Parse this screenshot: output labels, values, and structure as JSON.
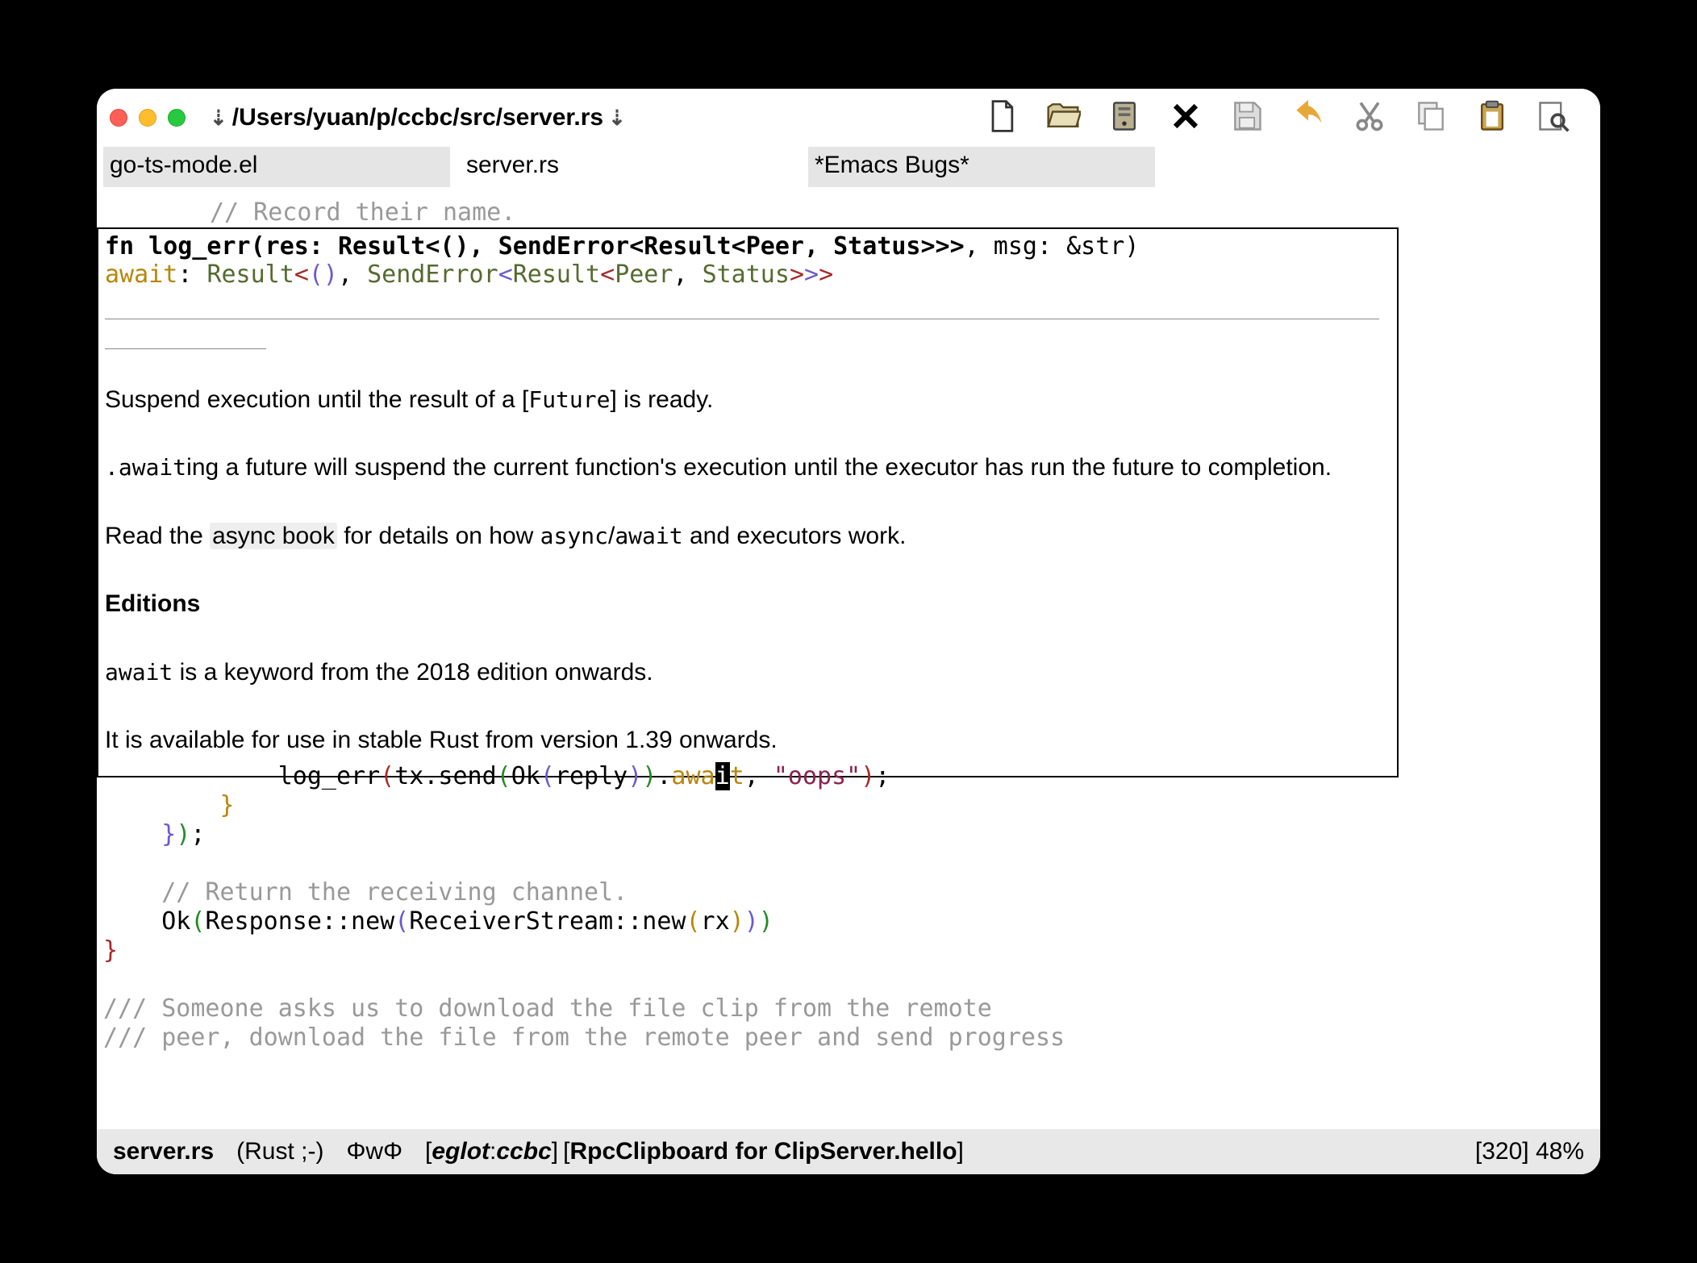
{
  "window": {
    "path": "/Users/yuan/p/ccbc/src/server.rs"
  },
  "tabs": [
    {
      "label": "go-ts-mode.el",
      "active": false
    },
    {
      "label": "server.rs",
      "active": true
    },
    {
      "label": "*Emacs Bugs*",
      "active": false
    }
  ],
  "top_comment": "// Record their name.",
  "eldoc": {
    "signature_bold": "fn log_err(res: Result<(), SendError<Result<Peer, Status>>>",
    "signature_tail": ", msg: &str)",
    "sig2_await": "await",
    "sig2_colon": ": ",
    "sig2_result": "Result",
    "sig2_lt1": "<",
    "sig2_unit": "()",
    "sig2_comma": ", ",
    "sig2_senderr": "SendError",
    "sig2_lt2": "<",
    "sig2_result2": "Result",
    "sig2_lt3": "<",
    "sig2_peer": "Peer",
    "sig2_comma2": ", ",
    "sig2_status": "Status",
    "sig2_gt3": ">",
    "sig2_gt2": ">",
    "sig2_gt1": ">",
    "doc": {
      "p1_pre": "Suspend execution until the result of a [",
      "p1_future": "Future",
      "p1_post": "] is ready.",
      "p2_pre": ".",
      "p2_await": "await",
      "p2_rest": "ing a future will suspend the current function's execution until the executor has run the future to completion.",
      "p3_pre": "Read the ",
      "p3_link": "async book",
      "p3_mid": " for details on how ",
      "p3_async": "async",
      "p3_slash": "/",
      "p3_await": "await",
      "p3_post": " and executors work.",
      "h4": "Editions",
      "p4_await": "await",
      "p4_rest": " is a keyword from the 2018 edition onwards.",
      "p5": "It is available for use in stable Rust from version 1.39 onwards."
    }
  },
  "code": {
    "l1_pre": "            log_err",
    "l1_p1o": "(",
    "l1_tx": "tx.send",
    "l1_p2o": "(",
    "l1_ok": "Ok",
    "l1_p3o": "(",
    "l1_reply": "reply",
    "l1_p3c": ")",
    "l1_p2c": ")",
    "l1_dot": ".",
    "l1_awa": "awa",
    "l1_cursor": "i",
    "l1_t": "t",
    "l1_comma": ", ",
    "l1_str": "\"oops\"",
    "l1_p1c": ")",
    "l1_semi": ";",
    "l2": "        }",
    "l3_pre": "    }",
    "l3_p": ")",
    "l3_semi": ";",
    "l5_cmt": "    // Return the receiving channel.",
    "l6_pre": "    Ok",
    "l6_p1o": "(",
    "l6_resp": "Response::new",
    "l6_p2o": "(",
    "l6_rs": "ReceiverStream::new",
    "l6_p3o": "(",
    "l6_rx": "rx",
    "l6_p3c": ")",
    "l6_p2c": ")",
    "l6_p1c": ")",
    "l7": "}",
    "l9_cmt": "/// Someone asks us to download the file clip from the remote",
    "l10_cmt": "/// peer, download the file from the remote peer and send progress"
  },
  "modeline": {
    "buffer": "server.rs",
    "mode": "(Rust ;-)",
    "phi": "ΦwΦ",
    "eglot_pre": "[",
    "eglot_name": "eglot",
    "eglot_colon": ":",
    "eglot_proj": "ccbc",
    "eglot_post": "]",
    "which_pre": "[",
    "which_fn": "RpcClipboard for ClipServer.hello",
    "which_post": "]",
    "right": "[320] 48%"
  }
}
